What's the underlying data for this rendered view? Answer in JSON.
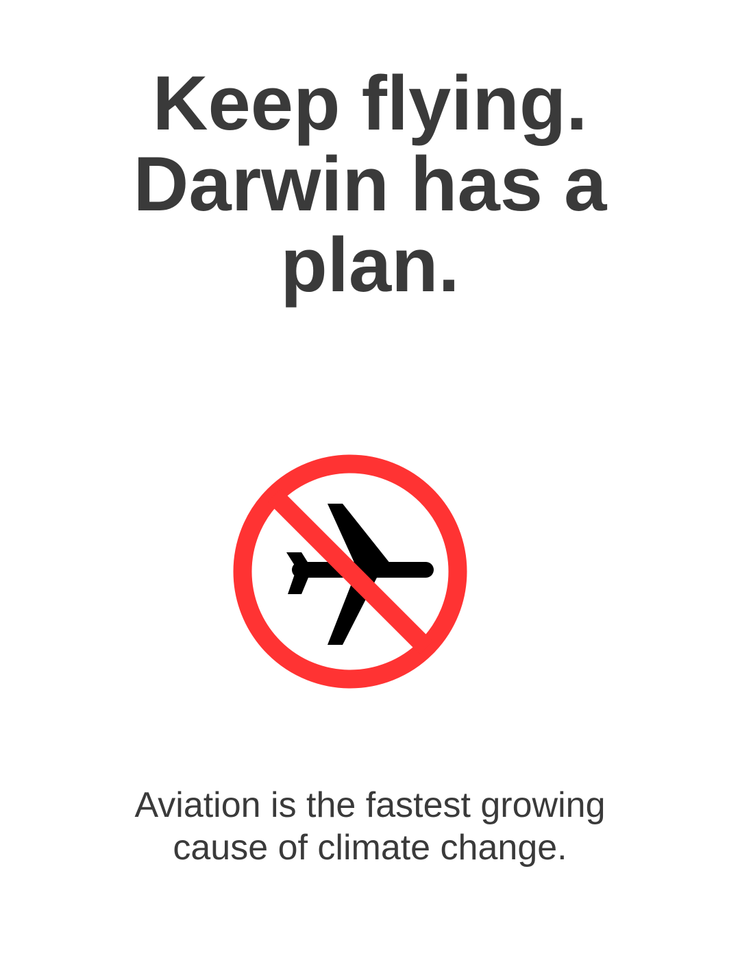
{
  "headline": {
    "lines": [
      "Keep flying.",
      "Darwin has a",
      "plan."
    ]
  },
  "sign": {
    "icon": "no-flying-icon",
    "ring_color": "#ff3333",
    "plane_color": "#000000"
  },
  "tagline": {
    "lines": [
      "Aviation is the fastest growing",
      "cause of climate change."
    ]
  },
  "colors": {
    "text": "#3a3a3a",
    "background": "#ffffff"
  }
}
